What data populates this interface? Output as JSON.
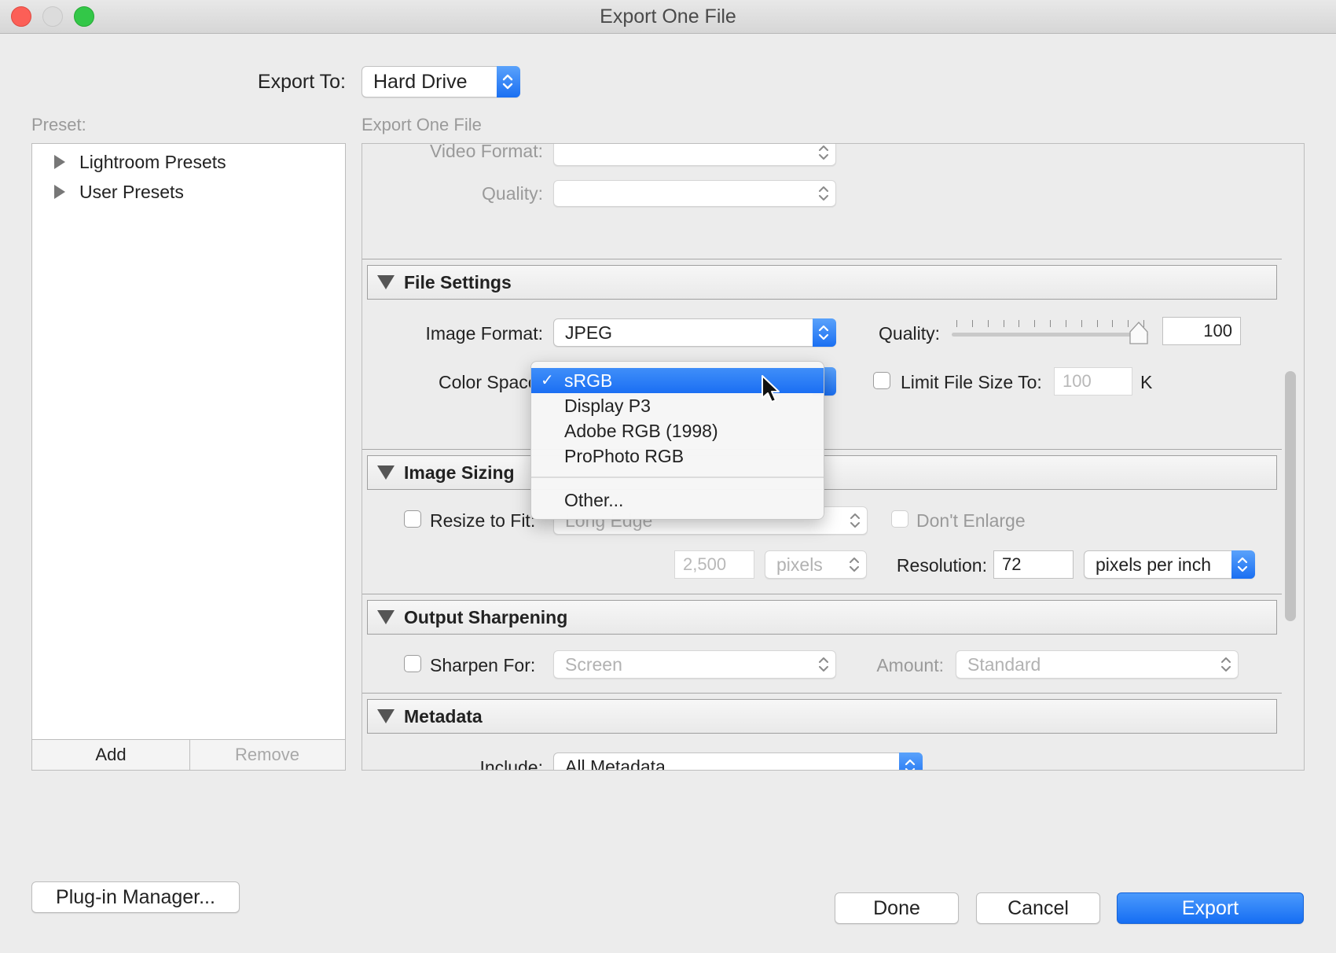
{
  "window": {
    "title": "Export One File"
  },
  "export_to": {
    "label": "Export To:",
    "value": "Hard Drive"
  },
  "preset": {
    "label": "Preset:",
    "items": [
      "Lightroom Presets",
      "User Presets"
    ],
    "add_label": "Add",
    "remove_label": "Remove"
  },
  "panel_title": "Export One File",
  "video": {
    "format_label": "Video Format:",
    "quality_label": "Quality:"
  },
  "file_settings": {
    "title": "File Settings",
    "image_format_label": "Image Format:",
    "image_format_value": "JPEG",
    "quality_label": "Quality:",
    "quality_value": "100",
    "quality_fraction": 1.0,
    "color_space_label": "Color Space:",
    "limit_label": "Limit File Size To:",
    "limit_value": "100",
    "limit_unit": "K"
  },
  "color_space_menu": {
    "items": [
      "sRGB",
      "Display P3",
      "Adobe RGB (1998)",
      "ProPhoto RGB"
    ],
    "selected": "sRGB",
    "other": "Other..."
  },
  "image_sizing": {
    "title": "Image Sizing",
    "resize_label": "Resize to Fit:",
    "resize_value": "Long Edge",
    "dont_enlarge_label": "Don't Enlarge",
    "size_value": "2,500",
    "size_unit": "pixels",
    "resolution_label": "Resolution:",
    "resolution_value": "72",
    "resolution_unit": "pixels per inch"
  },
  "output_sharpening": {
    "title": "Output Sharpening",
    "sharpen_label": "Sharpen For:",
    "sharpen_value": "Screen",
    "amount_label": "Amount:",
    "amount_value": "Standard"
  },
  "metadata": {
    "title": "Metadata",
    "include_label": "Include:",
    "include_value": "All Metadata"
  },
  "buttons": {
    "plugin_manager": "Plug-in Manager...",
    "done": "Done",
    "cancel": "Cancel",
    "export": "Export"
  },
  "colors": {
    "accent": "#1b6ff3",
    "menu_selected": "#2f80f6"
  }
}
